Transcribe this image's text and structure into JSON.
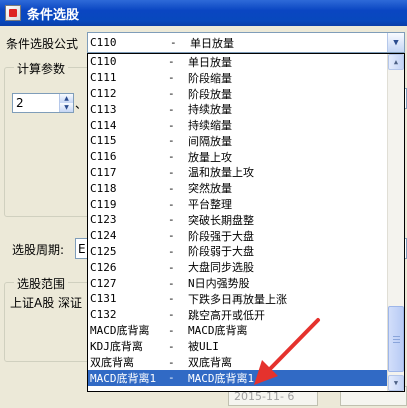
{
  "window": {
    "title": "条件选股"
  },
  "formula": {
    "label": "条件选股公式",
    "selected_code": "C110",
    "selected_sep": "-",
    "selected_name": "单日放量"
  },
  "params_group": {
    "title": "计算参数"
  },
  "param1": {
    "value": "2",
    "suffix": "、"
  },
  "period": {
    "label": "选股周期:",
    "value": "E"
  },
  "range_group": {
    "title": "选股范围"
  },
  "range": {
    "markets": "上证A股 深证"
  },
  "dates": {
    "start": "2015-11- 6"
  },
  "list_items": [
    {
      "code": "C110",
      "sep": "-",
      "name": "单日放量"
    },
    {
      "code": "C111",
      "sep": "-",
      "name": "阶段缩量"
    },
    {
      "code": "C112",
      "sep": "-",
      "name": "阶段放量"
    },
    {
      "code": "C113",
      "sep": "-",
      "name": "持续放量"
    },
    {
      "code": "C114",
      "sep": "-",
      "name": "持续缩量"
    },
    {
      "code": "C115",
      "sep": "-",
      "name": "间隔放量"
    },
    {
      "code": "C116",
      "sep": "-",
      "name": "放量上攻"
    },
    {
      "code": "C117",
      "sep": "-",
      "name": "温和放量上攻"
    },
    {
      "code": "C118",
      "sep": "-",
      "name": "突然放量"
    },
    {
      "code": "C119",
      "sep": "-",
      "name": "平台整理"
    },
    {
      "code": "C123",
      "sep": "-",
      "name": "突破长期盘整"
    },
    {
      "code": "C124",
      "sep": "-",
      "name": "阶段强于大盘"
    },
    {
      "code": "C125",
      "sep": "-",
      "name": "阶段弱于大盘"
    },
    {
      "code": "C126",
      "sep": "-",
      "name": "大盘同步选股"
    },
    {
      "code": "C127",
      "sep": "-",
      "name": "N日内强势股"
    },
    {
      "code": "C131",
      "sep": "-",
      "name": "下跌多日再放量上涨"
    },
    {
      "code": "C132",
      "sep": "-",
      "name": "跳空高开或低开"
    },
    {
      "code": "MACD底背离",
      "sep": "-",
      "name": "MACD底背离"
    },
    {
      "code": "KDJ底背离",
      "sep": "-",
      "name": "被ULI"
    },
    {
      "code": "双底背离",
      "sep": "-",
      "name": "双底背离"
    },
    {
      "code": "MACD底背离1",
      "sep": "-",
      "name": "MACD底背离1"
    }
  ],
  "selected_index": 20,
  "scroll_position": 0.85,
  "colors": {
    "selection": "#316ac5",
    "titlebar": "#0a46c2",
    "annotation_arrow": "#e5322d"
  },
  "icons": {
    "app": "app-icon",
    "combo_arrow": "chevron-down-icon",
    "scroll_up": "scroll-up-icon",
    "scroll_down": "scroll-down-icon"
  }
}
